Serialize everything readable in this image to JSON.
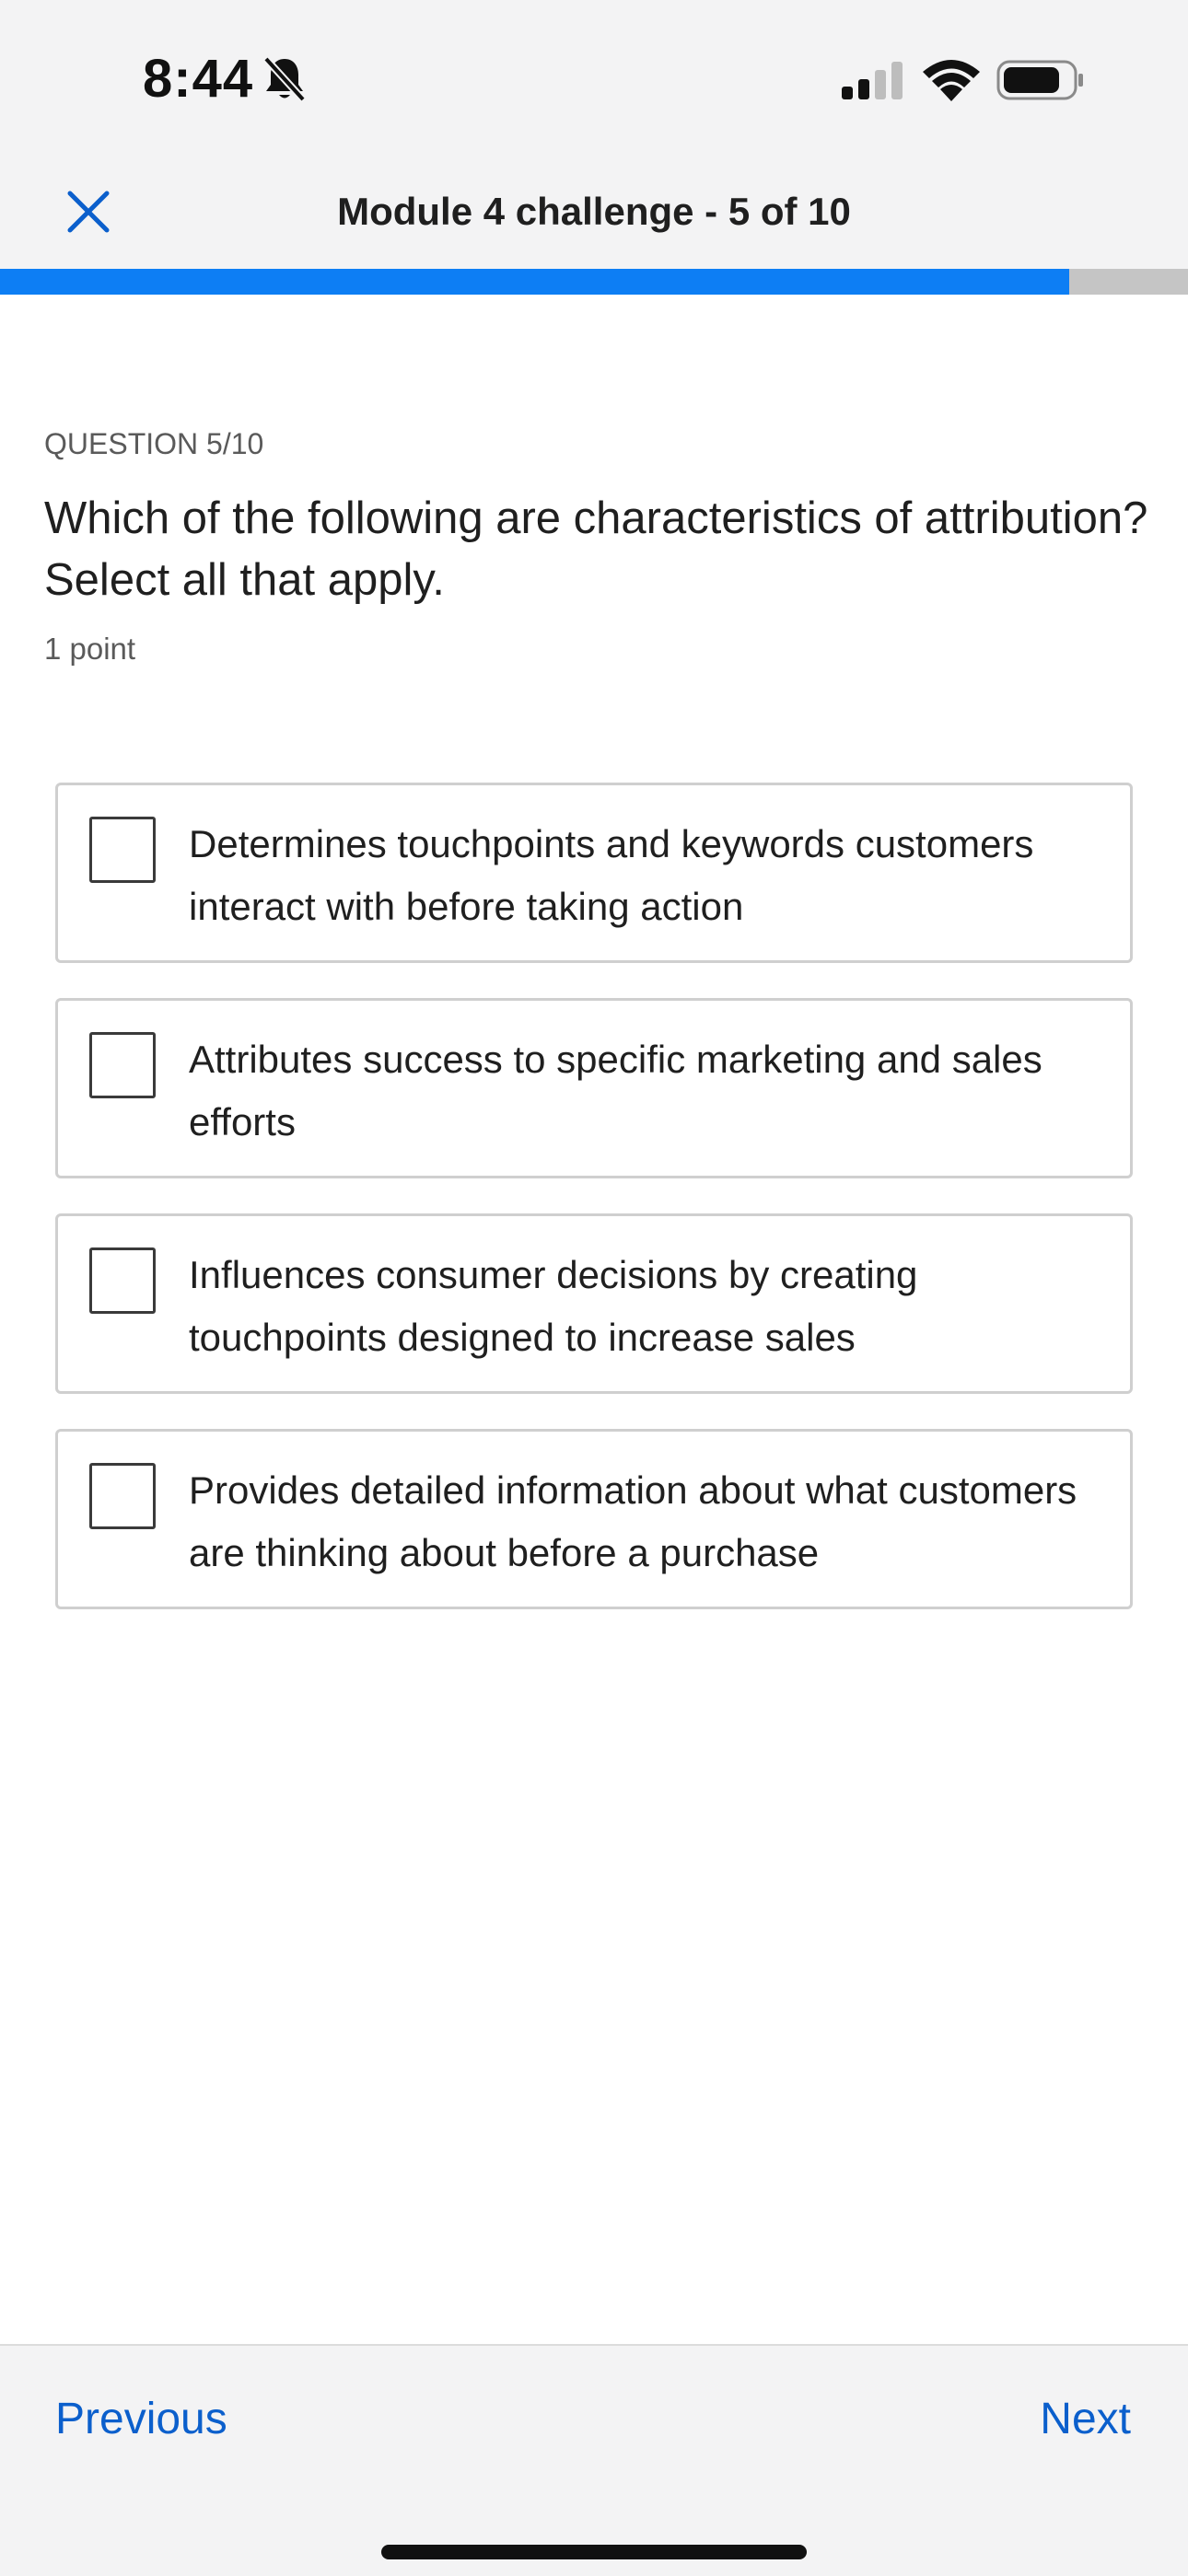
{
  "status_bar": {
    "time": "8:44",
    "bell_icon": "bell-slash-icon",
    "signal_icon": "cellular-signal-icon",
    "wifi_icon": "wifi-icon",
    "battery_icon": "battery-icon"
  },
  "header": {
    "close_icon": "close-icon",
    "title": "Module 4 challenge - 5 of 10",
    "accent_color": "#0b5fcc"
  },
  "progress": {
    "fraction": 0.9,
    "fill_color": "#0d7ef4",
    "track_color": "#c5c5c5"
  },
  "question": {
    "number_label": "QUESTION 5/10",
    "text": "Which of the following are characteristics of attribution? Select all that apply.",
    "points": "1 point"
  },
  "options": [
    {
      "label": "Determines touchpoints and keywords customers interact with before taking action",
      "checked": false
    },
    {
      "label": "Attributes success to specific marketing and sales efforts",
      "checked": false
    },
    {
      "label": "Influences consumer decisions by creating touchpoints designed to increase sales",
      "checked": false
    },
    {
      "label": "Provides detailed information about what customers are thinking about before a purchase",
      "checked": false
    }
  ],
  "footer": {
    "previous_label": "Previous",
    "next_label": "Next",
    "link_color": "#0b5fcc"
  }
}
